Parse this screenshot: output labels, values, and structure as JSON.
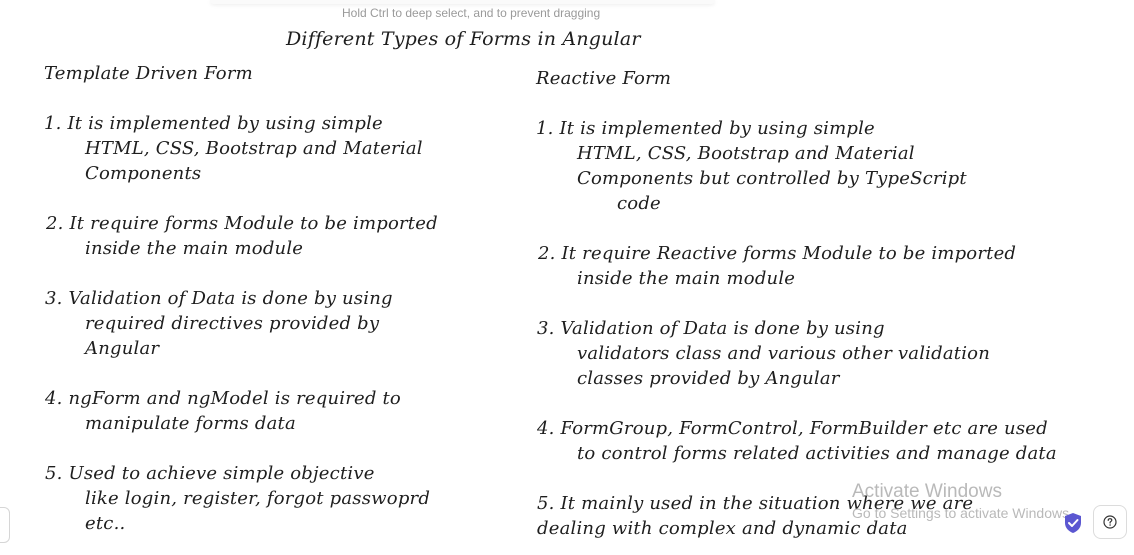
{
  "hint": "Hold Ctrl to deep select, and to prevent dragging",
  "title": "Different Types of Forms in Angular",
  "left": {
    "heading": "Template Driven Form",
    "lines": [
      "1. It is implemented by using simple",
      "HTML, CSS, Bootstrap and Material",
      "Components",
      "2. It require forms Module to be imported",
      "inside the main module",
      "3. Validation of Data is done by using",
      "required directives provided by",
      "Angular",
      "4. ngForm and ngModel is required to",
      "manipulate forms data",
      "5. Used to achieve simple objective",
      "like login, register, forgot passwoprd",
      "etc.."
    ]
  },
  "right": {
    "heading": "Reactive Form",
    "lines": [
      "1. It is implemented by using simple",
      "HTML, CSS, Bootstrap and Material",
      "Components but controlled by TypeScript",
      "code",
      "2. It require Reactive forms Module to be imported",
      "inside the main module",
      "3. Validation of Data is done by using",
      "validators class and various other validation",
      "classes provided by Angular",
      "4. FormGroup, FormControl, FormBuilder etc are used",
      "to control forms related activities and manage data",
      "5. It mainly used in the situation where we are",
      "dealing with complex and dynamic data"
    ]
  },
  "watermark": {
    "title": "Activate Windows",
    "subtitle": "Go to Settings to activate Windows."
  },
  "icons": {
    "shield": "shield-check-icon",
    "help": "help-icon"
  },
  "colors": {
    "ink": "#1e1e1e",
    "hint": "#9a9a9a",
    "watermark": "#b9b9b9",
    "shield": "#5b57d1"
  }
}
